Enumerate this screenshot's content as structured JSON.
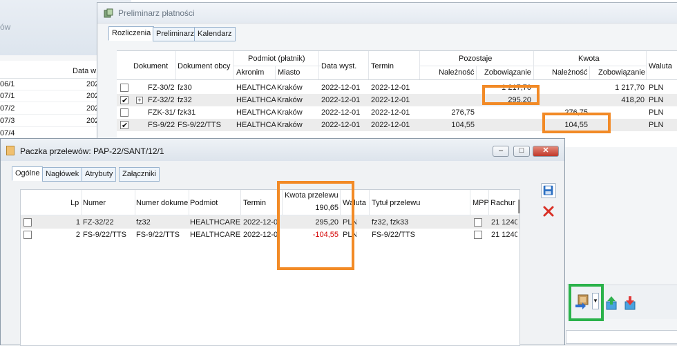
{
  "back_window": {
    "title_fragment": "ów",
    "column_header": "Data w",
    "rows": [
      {
        "doc": "06/1",
        "date": "202"
      },
      {
        "doc": "07/1",
        "date": "202"
      },
      {
        "doc": "07/2",
        "date": "202"
      },
      {
        "doc": "07/3",
        "date": "202"
      },
      {
        "doc": "07/4",
        "date": ""
      }
    ]
  },
  "mid_window": {
    "title": "Preliminarz płatności",
    "tabs": [
      "Rozliczenia",
      "Preliminarz",
      "Kalendarz"
    ],
    "active_tab": "Rozliczenia",
    "headers": {
      "dokument": "Dokument",
      "dokument_obcy": "Dokument obcy",
      "podmiot": "Podmiot (płatnik)",
      "akronim": "Akronim",
      "miasto": "Miasto",
      "data_wyst": "Data wyst.",
      "termin": "Termin",
      "pozostaje": "Pozostaje",
      "kwota": "Kwota",
      "naleznosc": "Należność",
      "zobowiazanie": "Zobowiązanie",
      "waluta": "Waluta"
    },
    "rows": [
      {
        "checked": false,
        "expand": false,
        "dokument": "FZ-30/2",
        "obcy": "fz30",
        "akronim": "HEALTHCAR",
        "miasto": "Kraków",
        "data": "2022-12-01",
        "termin": "2022-12-01",
        "poz_nal": "",
        "poz_zob": "1 217,70",
        "kw_nal": "",
        "kw_zob": "1 217,70",
        "waluta": "PLN"
      },
      {
        "checked": true,
        "expand": true,
        "dokument": "FZ-32/2",
        "obcy": "fz32",
        "akronim": "HEALTHCAR",
        "miasto": "Kraków",
        "data": "2022-12-01",
        "termin": "2022-12-01",
        "poz_nal": "",
        "poz_zob": "295,20",
        "kw_nal": "",
        "kw_zob": "418,20",
        "waluta": "PLN"
      },
      {
        "checked": false,
        "expand": false,
        "dokument": "FZK-31/",
        "obcy": "fzk31",
        "akronim": "HEALTHCAR",
        "miasto": "Kraków",
        "data": "2022-12-01",
        "termin": "2022-12-01",
        "poz_nal": "276,75",
        "poz_zob": "",
        "kw_nal": "276,75",
        "kw_zob": "",
        "waluta": "PLN"
      },
      {
        "checked": true,
        "expand": false,
        "dokument": "FS-9/22",
        "obcy": "FS-9/22/TTS",
        "akronim": "HEALTHCAR",
        "miasto": "Kraków",
        "data": "2022-12-01",
        "termin": "2022-12-01",
        "poz_nal": "104,55",
        "poz_zob": "",
        "kw_nal": "104,55",
        "kw_zob": "",
        "waluta": "PLN"
      }
    ]
  },
  "front_window": {
    "title": "Paczka przelewów: PAP-22/SANT/12/1",
    "tabs": [
      "Ogólne",
      "Nagłówek",
      "Atrybuty",
      "Załączniki"
    ],
    "active_tab": "Ogólne",
    "headers": {
      "lp": "Lp",
      "numer": "Numer",
      "numer_dok": "Numer dokumer",
      "podmiot": "Podmiot",
      "termin": "Termin",
      "kwota": "Kwota przelewu",
      "waluta": "Waluta",
      "tytul": "Tytuł przelewu",
      "mpp": "MPP",
      "rachunek": "Rachunek"
    },
    "total": "190,65",
    "rows": [
      {
        "lp": "1",
        "numer": "FZ-32/22",
        "numer_dok": "fz32",
        "podmiot": "HEALTHCARE",
        "termin": "2022-12-0",
        "kwota": "295,20",
        "negative": false,
        "waluta": "PLN",
        "tytul": "fz32, fzk33",
        "rachunek": "21 1240"
      },
      {
        "lp": "2",
        "numer": "FS-9/22/TTS",
        "numer_dok": "FS-9/22/TTS",
        "podmiot": "HEALTHCARE",
        "termin": "2022-12-0",
        "kwota": "-104,55",
        "negative": true,
        "waluta": "PLN",
        "tytul": "FS-9/22/TTS",
        "rachunek": "21 1240"
      }
    ],
    "window_buttons": [
      "minimize",
      "restore",
      "close"
    ]
  },
  "icons": {
    "save": "save-icon",
    "delete": "delete-icon",
    "send_transfer": "send-transfer-icon",
    "export": "export-icon",
    "import": "import-icon"
  },
  "colors": {
    "highlight_orange": "#f28a26",
    "highlight_green": "#2ab24a",
    "negative": "#d40000"
  }
}
